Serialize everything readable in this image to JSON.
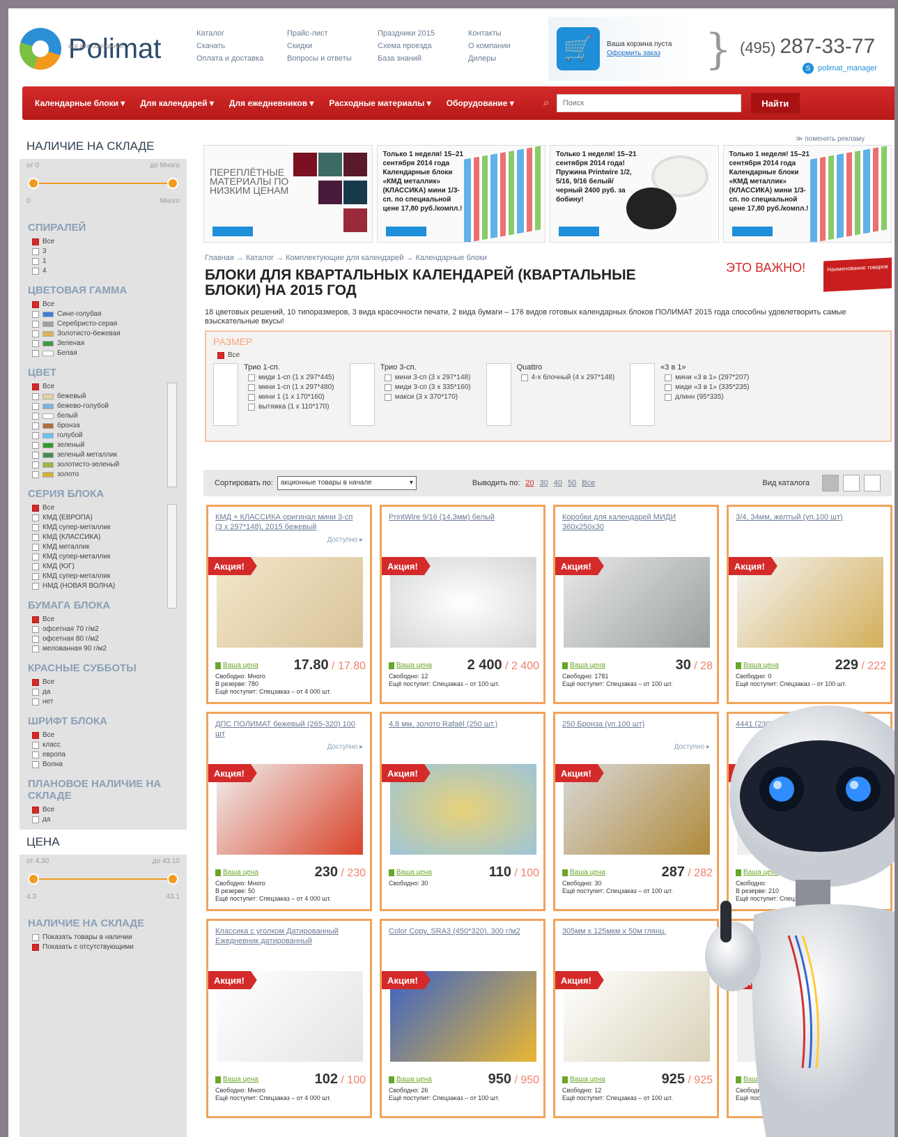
{
  "header": {
    "logo": "Polimat",
    "logo_tagline": "ВСЁ ДЛЯ КАЛЕНДАРЕЙ",
    "topnav": [
      "Каталог",
      "Прайс-лист",
      "Праздники 2015",
      "Контакты",
      "Скачать",
      "Скидки",
      "Схема проезда",
      "О компании",
      "Оплата и доставка",
      "Вопросы и ответы",
      "База знаний",
      "Дилеры"
    ],
    "cart_text": "Ваша корзина пуста",
    "cart_link": "Оформить заказ",
    "phone_code": "(495)",
    "phone_number": "287-33-77",
    "skype": "polimat_manager"
  },
  "nav": {
    "items": [
      "Календарные блоки ▾",
      "Для календарей ▾",
      "Для ежедневников ▾",
      "Расходные материалы ▾",
      "Оборудование ▾"
    ],
    "search_placeholder": "Поиск",
    "search_button": "Найти"
  },
  "sidebar": {
    "stock_title": "НАЛИЧИЕ НА СКЛАДЕ",
    "stock_from": "от 0",
    "stock_to": "до Много",
    "stock_min": "0",
    "stock_max": "Много",
    "spirals_title": "СПИРАЛЕЙ",
    "spirals": [
      {
        "label": "Все",
        "on": true
      },
      {
        "label": "3",
        "on": false
      },
      {
        "label": "1",
        "on": false
      },
      {
        "label": "4",
        "on": false
      }
    ],
    "gamma_title": "ЦВЕТОВАЯ ГАММА",
    "gamma": [
      {
        "label": "Все",
        "on": true,
        "color": ""
      },
      {
        "label": "Сине-голубая",
        "on": false,
        "color": "#3b7fd6"
      },
      {
        "label": "Серебристо-серая",
        "on": false,
        "color": "#9aa0a6"
      },
      {
        "label": "Золотисто-бежевая",
        "on": false,
        "color": "#d9b35a"
      },
      {
        "label": "Зеленая",
        "on": false,
        "color": "#3e9b3e"
      },
      {
        "label": "Белая",
        "on": false,
        "color": "#ffffff"
      }
    ],
    "color_title": "ЦВЕТ",
    "colors": [
      {
        "label": "Все",
        "on": true,
        "color": ""
      },
      {
        "label": "бежевый",
        "on": false,
        "color": "#e6d3a3"
      },
      {
        "label": "бежево-голубой",
        "on": false,
        "color": "#7fb2e6"
      },
      {
        "label": "белый",
        "on": false,
        "color": "#ffffff"
      },
      {
        "label": "бронза",
        "on": false,
        "color": "#b06d3b"
      },
      {
        "label": "голубой",
        "on": false,
        "color": "#6ec1ef"
      },
      {
        "label": "зеленый",
        "on": false,
        "color": "#2e9b2e"
      },
      {
        "label": "зеленый металлик",
        "on": false,
        "color": "#4a8a55"
      },
      {
        "label": "золотисто-зеленый",
        "on": false,
        "color": "#9ab93b"
      },
      {
        "label": "золото",
        "on": false,
        "color": "#d4af37"
      }
    ],
    "series_title": "СЕРИЯ БЛОКА",
    "series": [
      {
        "label": "Все",
        "on": true
      },
      {
        "label": "КМД (ЕВРОПА)",
        "on": false
      },
      {
        "label": "КМД супер-металлик",
        "on": false
      },
      {
        "label": "КМД (КЛАССИКА)",
        "on": false
      },
      {
        "label": "КМД металлик",
        "on": false
      },
      {
        "label": "КМД супер-металлик",
        "on": false
      },
      {
        "label": "КМД (ЮГ)",
        "on": false
      },
      {
        "label": "КМД супер-металлик",
        "on": false
      },
      {
        "label": "НМД (НОВАЯ ВОЛНА)",
        "on": false
      }
    ],
    "paper_title": "БУМАГА БЛОКА",
    "paper": [
      {
        "label": "Все",
        "on": true
      },
      {
        "label": "офсетная 70 г/м2",
        "on": false
      },
      {
        "label": "офсетная 80 г/м2",
        "on": false
      },
      {
        "label": "мелованная 90 г/м2",
        "on": false
      }
    ],
    "saturdays_title": "КРАСНЫЕ СУББОТЫ",
    "saturdays": [
      {
        "label": "Все",
        "on": true
      },
      {
        "label": "да",
        "on": false
      },
      {
        "label": "нет",
        "on": false
      }
    ],
    "font_title": "ШРИФТ БЛОКА",
    "fonts": [
      {
        "label": "Все",
        "on": true
      },
      {
        "label": "класс",
        "on": false
      },
      {
        "label": "европа",
        "on": false
      },
      {
        "label": "Волна",
        "on": false
      }
    ],
    "planned_title": "ПЛАНОВОЕ НАЛИЧИЕ НА СКЛАДЕ",
    "planned": [
      {
        "label": "Все",
        "on": true
      },
      {
        "label": "да",
        "on": false
      }
    ],
    "price_title": "ЦЕНА",
    "price_from": "от 4.30",
    "price_to": "до 43.10",
    "price_min": "4.3",
    "price_max": "43.1",
    "avail_title": "НАЛИЧИЕ НА СКЛАДЕ",
    "avail": [
      {
        "label": "Показать товары в наличии",
        "on": false
      },
      {
        "label": "Показать с отсутствующими",
        "on": true
      }
    ]
  },
  "banners": {
    "change": "≫ поменять рекламу",
    "first": "ПЕРЕПЛЁТНЫЕ МАТЕРИАЛЫ ПО НИЗКИМ ЦЕНАМ",
    "second": "Только 1 неделя! 15–21 сентября 2014 года Календарные блоки «КМД металлик» (КЛАССИКА) мини 1/3-сп. по специальной цене 17,80 руб./компл.!",
    "third": "Только 1 неделя! 15–21 сентября 2014 года! Пружина Printwire 1/2, 5/16, 9/16 белый/черный 2400 руб. за бобину!",
    "fourth": "Только 1 неделя! 15–21 сентября 2014 года Календарные блоки «КМД металлик» (КЛАССИКА) мини 1/3-сп. по специальной цене 17,80 руб./компл.!"
  },
  "breadcrumbs": "Главная → Каталог → Комплектующие для календарей → Календарные блоки",
  "page_title": "БЛОКИ ДЛЯ КВАРТАЛЬНЫХ КАЛЕНДАРЕЙ (КВАРТАЛЬНЫЕ БЛОКИ) НА 2015 ГОД",
  "important": "ЭТО ВАЖНО!",
  "important_ribbon": "Наименование товаров",
  "description": "18 цветовых решений, 10 типоразмеров, 3 вида красочности печати, 2 вида бумаги – 176 видов готовых календарных блоков ПОЛИМАТ 2015 года способны удовлетворить самые взыскательные вкусы!",
  "size": {
    "title": "РАЗМЕР",
    "all": "Все",
    "groups": [
      {
        "title": "Трио 1-сп.",
        "items": [
          "миди 1-сп (1 x 297*445)",
          "мини 1-сп (1 x 297*480)",
          "мини 1 (1 x 170*160)",
          "вытяжка (1 x 110*170)"
        ]
      },
      {
        "title": "Трио 3-сп.",
        "items": [
          "мини 3-сп (3 x 297*148)",
          "миди 3-сп (3 x 335*160)",
          "макси (3 x 370*170)"
        ]
      },
      {
        "title": "Quattro",
        "items": [
          "4-х блочный (4 x 297*148)"
        ]
      },
      {
        "title": "«3 в 1»",
        "items": [
          "мини «3 в 1» (297*207)",
          "миди «3 в 1» (335*235)",
          "длинн (95*335)"
        ]
      }
    ]
  },
  "sort": {
    "label": "Сортировать по:",
    "value": "акционные товары в начале",
    "perpage_label": "Выводить по:",
    "perpage": [
      "20",
      "30",
      "40",
      "50",
      "Все"
    ],
    "view_label": "Вид каталога"
  },
  "products": [
    {
      "name": "КМД + КЛАССИКА оригинал мини 3-сп (3 x 297*148), 2015 бежевый",
      "avail": "Доступно ▸",
      "price": "17.80",
      "old": "17.80",
      "your_price": "Ваша цена",
      "free": "Свободно: Много",
      "reserve": "В резерве: 780",
      "arrival": "Ещё поступит: Спецзаказ – от 4 000 шт."
    },
    {
      "name": "PrintWire 9/16 (14,3мм) белый",
      "avail": "",
      "price": "2 400",
      "old": "2 400",
      "your_price": "Ваша цена",
      "free": "Свободно: 12",
      "reserve": "",
      "arrival": "Ещё поступит: Спецзаказ – от 100 шт."
    },
    {
      "name": "Коробки для календарей МИДИ 360x250x30",
      "avail": "",
      "price": "30",
      "old": "28",
      "your_price": "Ваша цена",
      "free": "Свободно: 1781",
      "reserve": "",
      "arrival": "Ещё поступит: Спецзаказ – от 100 шт."
    },
    {
      "name": "3/4, 34мм, желтый (уп.100 шт)",
      "avail": "",
      "price": "229",
      "old": "222",
      "your_price": "Ваша цена",
      "free": "Свободно: 0",
      "reserve": "",
      "arrival": "Ещё поступит: Спецзаказ – от 100 шт."
    },
    {
      "name": "ДПС ПОЛИМАТ бежевый (265-320) 100 шт",
      "avail": "Доступно ▸",
      "price": "230",
      "old": "230",
      "your_price": "Ваша цена",
      "free": "Свободно: Много",
      "reserve": "В резерве: 50",
      "arrival": "Ещё поступит: Спецзаказ – от 4 000 шт."
    },
    {
      "name": "4,8 мм, золото Rafaël (250 шт.)",
      "avail": "",
      "price": "110",
      "old": "100",
      "your_price": "Ваша цена",
      "free": "Свободно: 30",
      "reserve": "",
      "arrival": ""
    },
    {
      "name": "250 Бронза (уп.100 шт)",
      "avail": "Доступно ▸",
      "price": "287",
      "old": "282",
      "your_price": "Ваша цена",
      "free": "Свободно: 30",
      "reserve": "",
      "arrival": "Ещё поступит: Спецзаказ – от 100 шт."
    },
    {
      "name": "4441 (230) шт черный",
      "avail": "",
      "price": "",
      "old": "",
      "your_price": "Ваша цена",
      "free": "Свободно:",
      "reserve": "В резерве: 210",
      "arrival": "Ещё поступит: Спецзаказ"
    },
    {
      "name": "Классика с уголком Датированный Ежедневник датированный",
      "avail": "",
      "price": "102",
      "old": "100",
      "your_price": "Ваша цена",
      "free": "Свободно: Много",
      "reserve": "",
      "arrival": "Ещё поступит: Спецзаказ – от 4 000 шт."
    },
    {
      "name": "Color Copy, SRA3 (450*320), 300 г/м2",
      "avail": "",
      "price": "950",
      "old": "950",
      "your_price": "Ваша цена",
      "free": "Свободно: 26",
      "reserve": "",
      "arrival": "Ещё поступит: Спецзаказ – от 100 шт."
    },
    {
      "name": "305мм x 125мкм x 50м глянц.",
      "avail": "",
      "price": "925",
      "old": "925",
      "your_price": "Ваша цена",
      "free": "Свободно: 12",
      "reserve": "",
      "arrival": "Ещё поступит: Спецзаказ – от 100 шт."
    },
    {
      "name": "",
      "avail": "",
      "price": "",
      "old": "",
      "your_price": "Ваша цена",
      "free": "Свободно:",
      "reserve": "",
      "arrival": "Ещё поступит:"
    }
  ],
  "promo_label": "Акция!"
}
